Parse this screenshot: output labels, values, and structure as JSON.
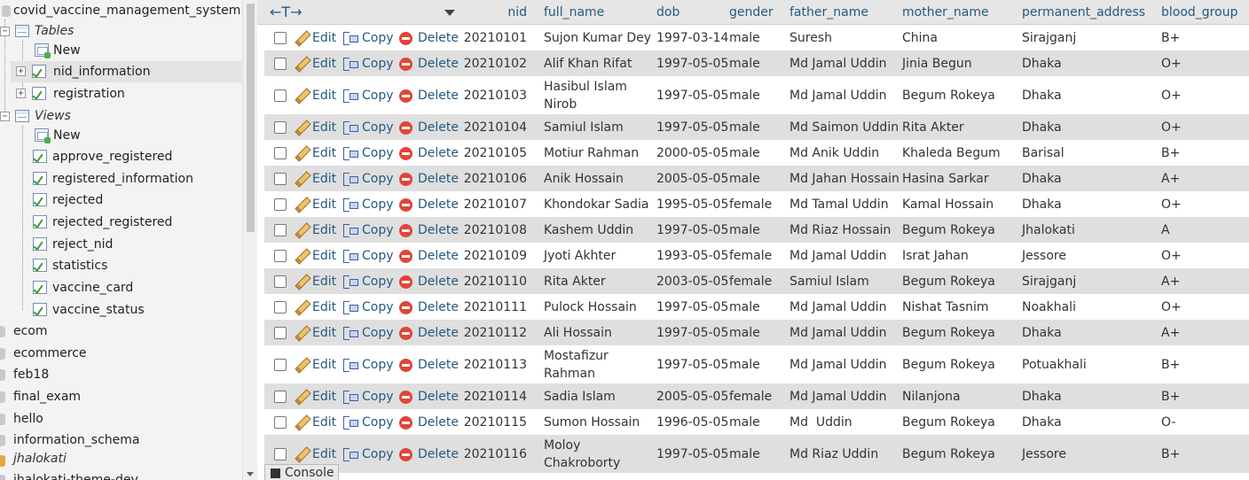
{
  "nav": {
    "db_current": "covid_vaccine_management_system",
    "tables_label": "Tables",
    "new_label": "New",
    "tables": [
      "nid_information",
      "registration"
    ],
    "views_label": "Views",
    "views": [
      "approve_registered",
      "registered_information",
      "rejected",
      "rejected_registered",
      "reject_nid",
      "statistics",
      "vaccine_card",
      "vaccine_status"
    ],
    "other_dbs": [
      "ecom",
      "ecommerce",
      "feb18",
      "final_exam",
      "hello",
      "information_schema",
      "jhalokati",
      "jhalokati-theme-dev"
    ]
  },
  "table": {
    "nav_arrows": "←T→",
    "columns": [
      "nid",
      "full_name",
      "dob",
      "gender",
      "father_name",
      "mother_name",
      "permanent_address",
      "blood_group"
    ],
    "actions": {
      "edit": "Edit",
      "copy": "Copy",
      "delete": "Delete"
    },
    "rows": [
      {
        "nid": "20210101",
        "full_name": [
          "Sujon Kumar Dey"
        ],
        "dob": "1997-03-14",
        "gender": "male",
        "father_name": "Suresh",
        "mother_name": "China",
        "permanent_address": "Sirajganj",
        "blood_group": "B+"
      },
      {
        "nid": "20210102",
        "full_name": [
          "Alif Khan Rifat"
        ],
        "dob": "1997-05-05",
        "gender": "male",
        "father_name": "Md Jamal Uddin",
        "mother_name": "Jinia Begun",
        "permanent_address": "Dhaka",
        "blood_group": "O+"
      },
      {
        "nid": "20210103",
        "full_name": [
          "Hasibul Islam",
          "Nirob"
        ],
        "dob": "1997-05-05",
        "gender": "male",
        "father_name": "Md Jamal Uddin",
        "mother_name": "Begum Rokeya",
        "permanent_address": "Dhaka",
        "blood_group": "O+"
      },
      {
        "nid": "20210104",
        "full_name": [
          "Samiul Islam"
        ],
        "dob": "1997-05-05",
        "gender": "male",
        "father_name": "Md Saimon Uddin",
        "mother_name": "Rita Akter",
        "permanent_address": "Dhaka",
        "blood_group": "O+"
      },
      {
        "nid": "20210105",
        "full_name": [
          "Motiur Rahman"
        ],
        "dob": "2000-05-05",
        "gender": "male",
        "father_name": "Md Anik Uddin",
        "mother_name": "Khaleda Begum",
        "permanent_address": "Barisal",
        "blood_group": "B+"
      },
      {
        "nid": "20210106",
        "full_name": [
          "Anik Hossain"
        ],
        "dob": "2005-05-05",
        "gender": "male",
        "father_name": "Md Jahan Hossain",
        "mother_name": "Hasina Sarkar",
        "permanent_address": "Dhaka",
        "blood_group": "A+"
      },
      {
        "nid": "20210107",
        "full_name": [
          "Khondokar Sadia"
        ],
        "dob": "1995-05-05",
        "gender": "female",
        "father_name": "Md Tamal Uddin",
        "mother_name": "Kamal Hossain",
        "permanent_address": "Dhaka",
        "blood_group": "O+"
      },
      {
        "nid": "20210108",
        "full_name": [
          "Kashem Uddin"
        ],
        "dob": "1997-05-05",
        "gender": "male",
        "father_name": "Md Riaz Hossain",
        "mother_name": "Begum Rokeya",
        "permanent_address": "Jhalokati",
        "blood_group": "A"
      },
      {
        "nid": "20210109",
        "full_name": [
          "Jyoti Akhter"
        ],
        "dob": "1993-05-05",
        "gender": "female",
        "father_name": "Md Jamal Uddin",
        "mother_name": "Israt Jahan",
        "permanent_address": "Jessore",
        "blood_group": "O+"
      },
      {
        "nid": "20210110",
        "full_name": [
          "Rita Akter"
        ],
        "dob": "2003-05-05",
        "gender": "female",
        "father_name": "Samiul Islam",
        "mother_name": "Begum Rokeya",
        "permanent_address": "Sirajganj",
        "blood_group": "A+"
      },
      {
        "nid": "20210111",
        "full_name": [
          "Pulock Hossain"
        ],
        "dob": "1997-05-05",
        "gender": "male",
        "father_name": "Md Jamal Uddin",
        "mother_name": "Nishat Tasnim",
        "permanent_address": "Noakhali",
        "blood_group": "O+"
      },
      {
        "nid": "20210112",
        "full_name": [
          "Ali Hossain"
        ],
        "dob": "1997-05-05",
        "gender": "male",
        "father_name": "Md Jamal Uddin",
        "mother_name": "Begum Rokeya",
        "permanent_address": "Dhaka",
        "blood_group": "A+"
      },
      {
        "nid": "20210113",
        "full_name": [
          "Mostafizur",
          "Rahman"
        ],
        "dob": "1997-05-05",
        "gender": "male",
        "father_name": "Md Jamal Uddin",
        "mother_name": "Begum Rokeya",
        "permanent_address": "Potuakhali",
        "blood_group": "B+"
      },
      {
        "nid": "20210114",
        "full_name": [
          "Sadia Islam"
        ],
        "dob": "2005-05-05",
        "gender": "female",
        "father_name": "Md Jamal Uddin",
        "mother_name": "Nilanjona",
        "permanent_address": "Dhaka",
        "blood_group": "B+"
      },
      {
        "nid": "20210115",
        "full_name": [
          "Sumon Hossain"
        ],
        "dob": "1996-05-05",
        "gender": "male",
        "father_name": "Md  Uddin",
        "mother_name": "Begum Rokeya",
        "permanent_address": "Dhaka",
        "blood_group": "O-"
      },
      {
        "nid": "20210116",
        "full_name": [
          "Moloy",
          "Chakroborty"
        ],
        "dob": "1997-05-05",
        "gender": "male",
        "father_name": "Md Riaz Uddin",
        "mother_name": "Begum Rokeya",
        "permanent_address": "Jessore",
        "blood_group": "B+"
      }
    ]
  },
  "console_label": "Console"
}
